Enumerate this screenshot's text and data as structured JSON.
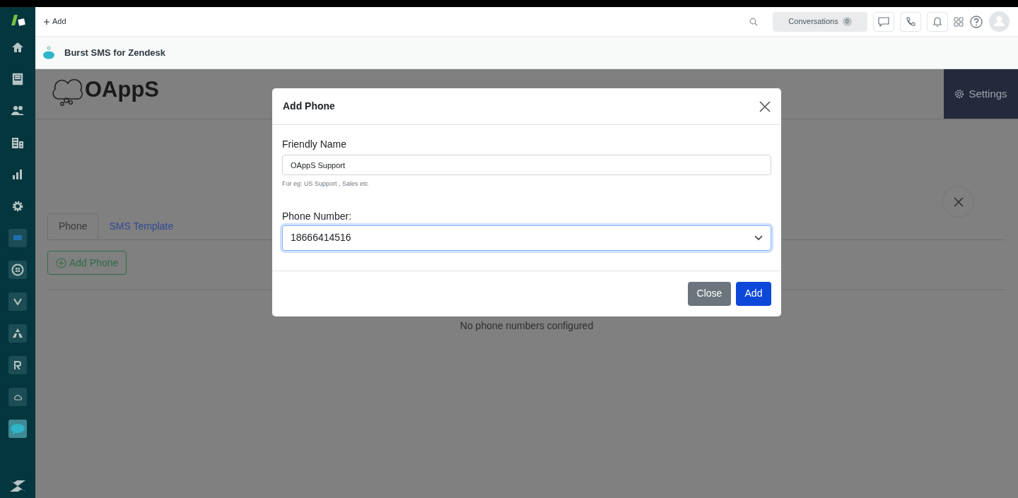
{
  "top_bar": {
    "add_label": "Add",
    "conversations": {
      "label": "Conversations",
      "count": "0"
    }
  },
  "app_bar": {
    "title": "Burst SMS for Zendesk"
  },
  "sidebar": {
    "apps": [
      {
        "kind": "chat",
        "selected": false
      },
      {
        "kind": "grid",
        "selected": false
      },
      {
        "kind": "v",
        "selected": false
      },
      {
        "kind": "triangle",
        "selected": false
      },
      {
        "kind": "r",
        "selected": false
      },
      {
        "kind": "cloud",
        "selected": false
      },
      {
        "kind": "sms",
        "selected": true
      }
    ]
  },
  "app": {
    "logo_text": "OAppS",
    "settings_label": "Settings",
    "tabs": [
      {
        "label": "Phone",
        "selected": true
      },
      {
        "label": "SMS Template",
        "selected": false
      }
    ],
    "add_phone_label": "Add Phone",
    "empty_message": "No phone numbers configured"
  },
  "dialog": {
    "title": "Add Phone",
    "friendly_name": {
      "label": "Friendly Name",
      "value": "OAppS Support",
      "hint": "For eg: US Support , Sales etc"
    },
    "phone_number": {
      "label": "Phone Number:",
      "value": "18666414516"
    },
    "buttons": [
      {
        "kind": "secondary",
        "label": "Close"
      },
      {
        "kind": "primary",
        "label": "Add"
      }
    ]
  }
}
